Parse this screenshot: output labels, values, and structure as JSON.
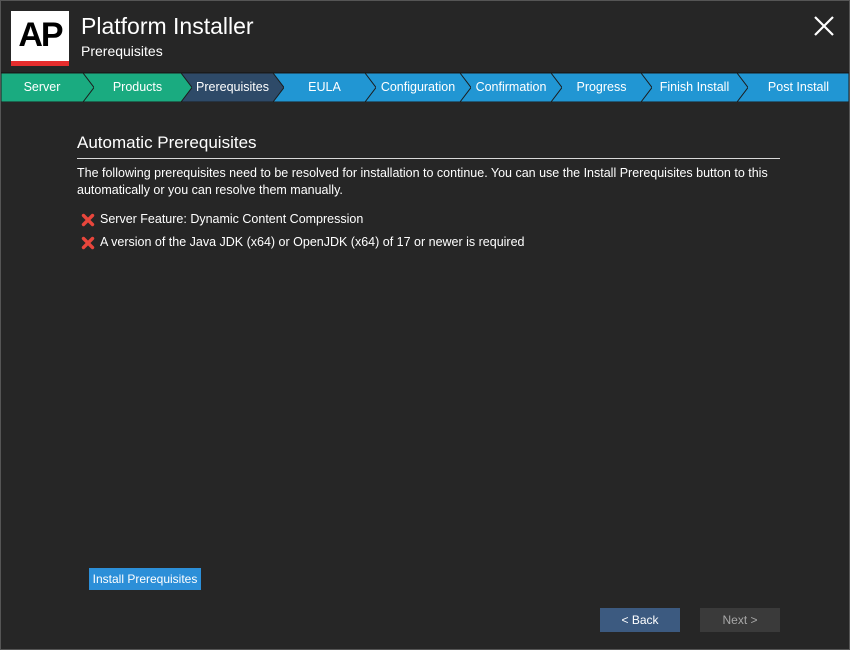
{
  "header": {
    "logo_text": "AP",
    "title": "Platform Installer",
    "subtitle": "Prerequisites",
    "close_icon": "close-icon"
  },
  "steps": [
    {
      "label": "Server",
      "state": "completed",
      "color": "#1aab80"
    },
    {
      "label": "Products",
      "state": "completed",
      "color": "#1aab80"
    },
    {
      "label": "Prerequisites",
      "state": "current",
      "color": "#2e4a68"
    },
    {
      "label": "EULA",
      "state": "upcoming",
      "color": "#2196d3"
    },
    {
      "label": "Configuration",
      "state": "upcoming",
      "color": "#2196d3"
    },
    {
      "label": "Confirmation",
      "state": "upcoming",
      "color": "#2196d3"
    },
    {
      "label": "Progress",
      "state": "upcoming",
      "color": "#2196d3"
    },
    {
      "label": "Finish Install",
      "state": "upcoming",
      "color": "#2196d3"
    },
    {
      "label": "Post Install",
      "state": "upcoming",
      "color": "#2196d3"
    }
  ],
  "content": {
    "section_title": "Automatic Prerequisites",
    "description": "The following prerequisites need to be resolved for installation to continue. You can use the Install Prerequisites button to this automatically or you can resolve them manually.",
    "prerequisites": [
      {
        "icon": "error-x-icon",
        "text": "Server Feature:  Dynamic Content Compression"
      },
      {
        "icon": "error-x-icon",
        "text": "A version of the Java JDK (x64) or OpenJDK (x64) of 17 or newer is required"
      }
    ]
  },
  "buttons": {
    "install_label": "Install Prerequisites",
    "back_label": "< Back",
    "next_label": "Next >",
    "next_enabled": false
  },
  "colors": {
    "background": "#262626",
    "completed": "#1aab80",
    "current": "#2e4a68",
    "upcoming": "#2196d3",
    "error": "#e8463c",
    "accent_button": "#2c8fd8"
  }
}
